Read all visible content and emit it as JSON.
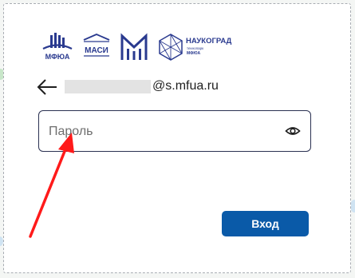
{
  "logos": {
    "mfua": "МФЮА",
    "masi": "МАСИ",
    "naukograd_title": "НАУКОГРАД",
    "naukograd_sub1": "технопарк",
    "naukograd_sub2": "МФЮА"
  },
  "login": {
    "email_domain": "@s.mfua.ru",
    "password_placeholder": "Пароль",
    "submit_label": "Вход"
  },
  "icons": {
    "back": "arrow-left-icon",
    "toggle_visibility": "eye-icon"
  },
  "colors": {
    "primary_button": "#0a5aa8",
    "field_border": "#2b3152",
    "logo": "#2a3a8f",
    "annotation_arrow": "#ff1a1a"
  }
}
